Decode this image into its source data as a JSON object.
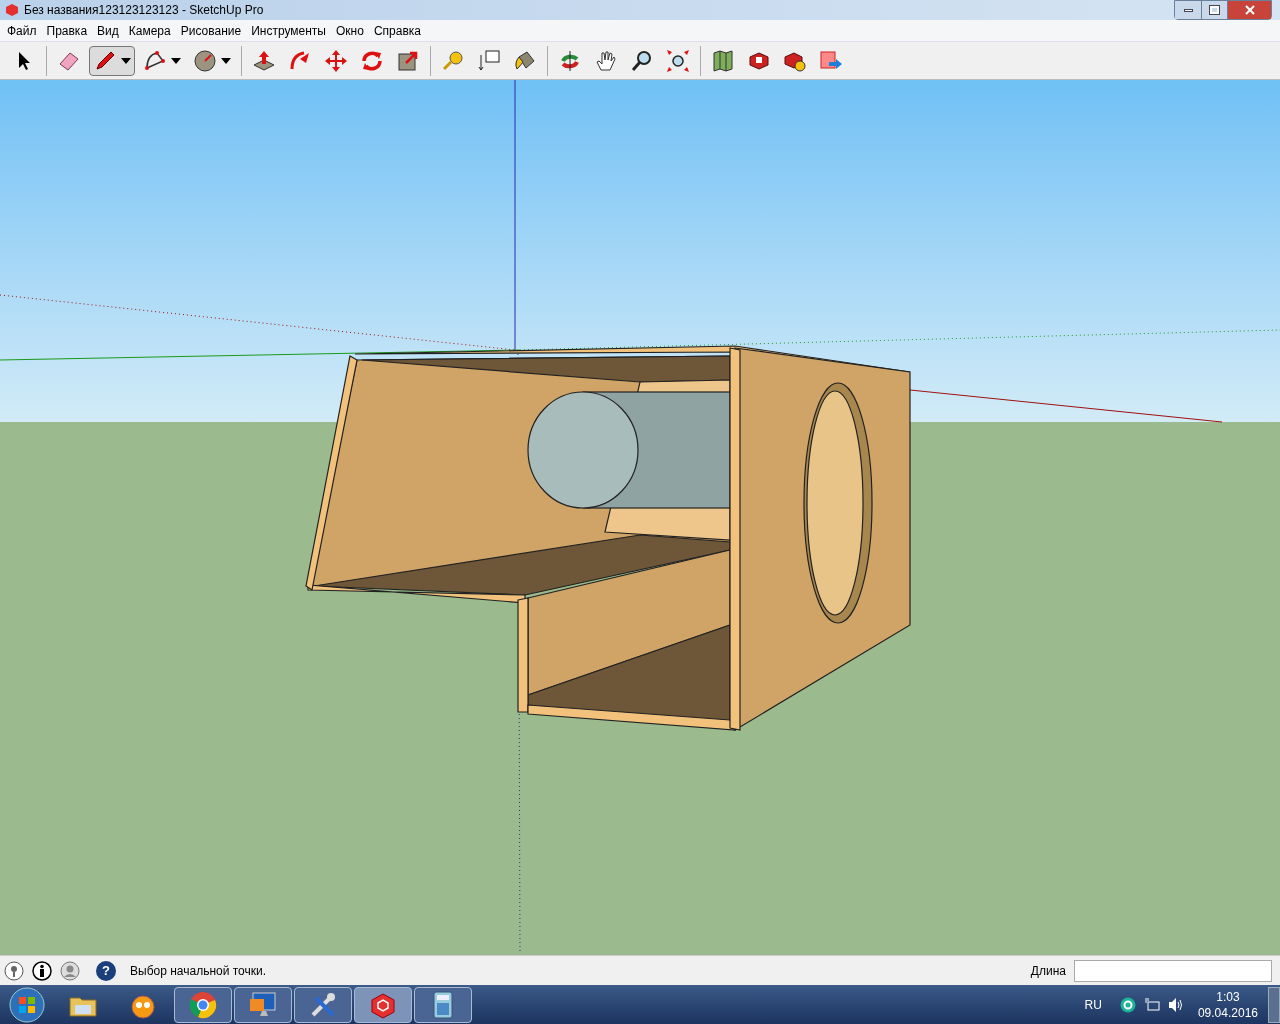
{
  "window": {
    "title": "Без названия123123123123 - SketchUp Pro"
  },
  "menu": [
    {
      "label": "Файл"
    },
    {
      "label": "Правка"
    },
    {
      "label": "Вид"
    },
    {
      "label": "Камера"
    },
    {
      "label": "Рисование"
    },
    {
      "label": "Инструменты"
    },
    {
      "label": "Окно"
    },
    {
      "label": "Справка"
    }
  ],
  "toolbar": {
    "groups": [
      [
        {
          "kind": "select",
          "selected": false,
          "dropdown": false
        }
      ],
      [
        {
          "kind": "eraser",
          "selected": false,
          "dropdown": false
        },
        {
          "kind": "pencil",
          "selected": true,
          "dropdown": true
        },
        {
          "kind": "arc",
          "selected": false,
          "dropdown": true
        },
        {
          "kind": "circle",
          "selected": false,
          "dropdown": true
        }
      ],
      [
        {
          "kind": "pushpull",
          "selected": false,
          "dropdown": false
        },
        {
          "kind": "followme",
          "selected": false,
          "dropdown": false
        },
        {
          "kind": "move",
          "selected": false,
          "dropdown": false
        },
        {
          "kind": "rotate",
          "selected": false,
          "dropdown": false
        },
        {
          "kind": "scale",
          "selected": false,
          "dropdown": false
        }
      ],
      [
        {
          "kind": "tape",
          "selected": false,
          "dropdown": false
        },
        {
          "kind": "text",
          "selected": false,
          "dropdown": false
        },
        {
          "kind": "paint",
          "selected": false,
          "dropdown": false
        }
      ],
      [
        {
          "kind": "orbit",
          "selected": false,
          "dropdown": false
        },
        {
          "kind": "pan",
          "selected": false,
          "dropdown": false
        },
        {
          "kind": "zoom",
          "selected": false,
          "dropdown": false
        },
        {
          "kind": "extents",
          "selected": false,
          "dropdown": false
        }
      ],
      [
        {
          "kind": "map",
          "selected": false,
          "dropdown": false
        },
        {
          "kind": "warehouse",
          "selected": false,
          "dropdown": false
        },
        {
          "kind": "share",
          "selected": false,
          "dropdown": false
        },
        {
          "kind": "export",
          "selected": false,
          "dropdown": false
        }
      ]
    ]
  },
  "status_bar": {
    "help_glyph": "?",
    "message": "Выбор начальной точки.",
    "measure_label": "Длина"
  },
  "taskbar": {
    "apps": [
      {
        "kind": "folder",
        "running": false,
        "active": false
      },
      {
        "kind": "media",
        "running": false,
        "active": false
      },
      {
        "kind": "browser",
        "running": true,
        "active": false
      },
      {
        "kind": "monitor",
        "running": true,
        "active": false
      },
      {
        "kind": "tools",
        "running": true,
        "active": false
      },
      {
        "kind": "sketchup",
        "running": true,
        "active": true
      },
      {
        "kind": "calculator",
        "running": true,
        "active": false
      }
    ],
    "language": "RU",
    "time": "1:03",
    "date": "09.04.2016"
  }
}
